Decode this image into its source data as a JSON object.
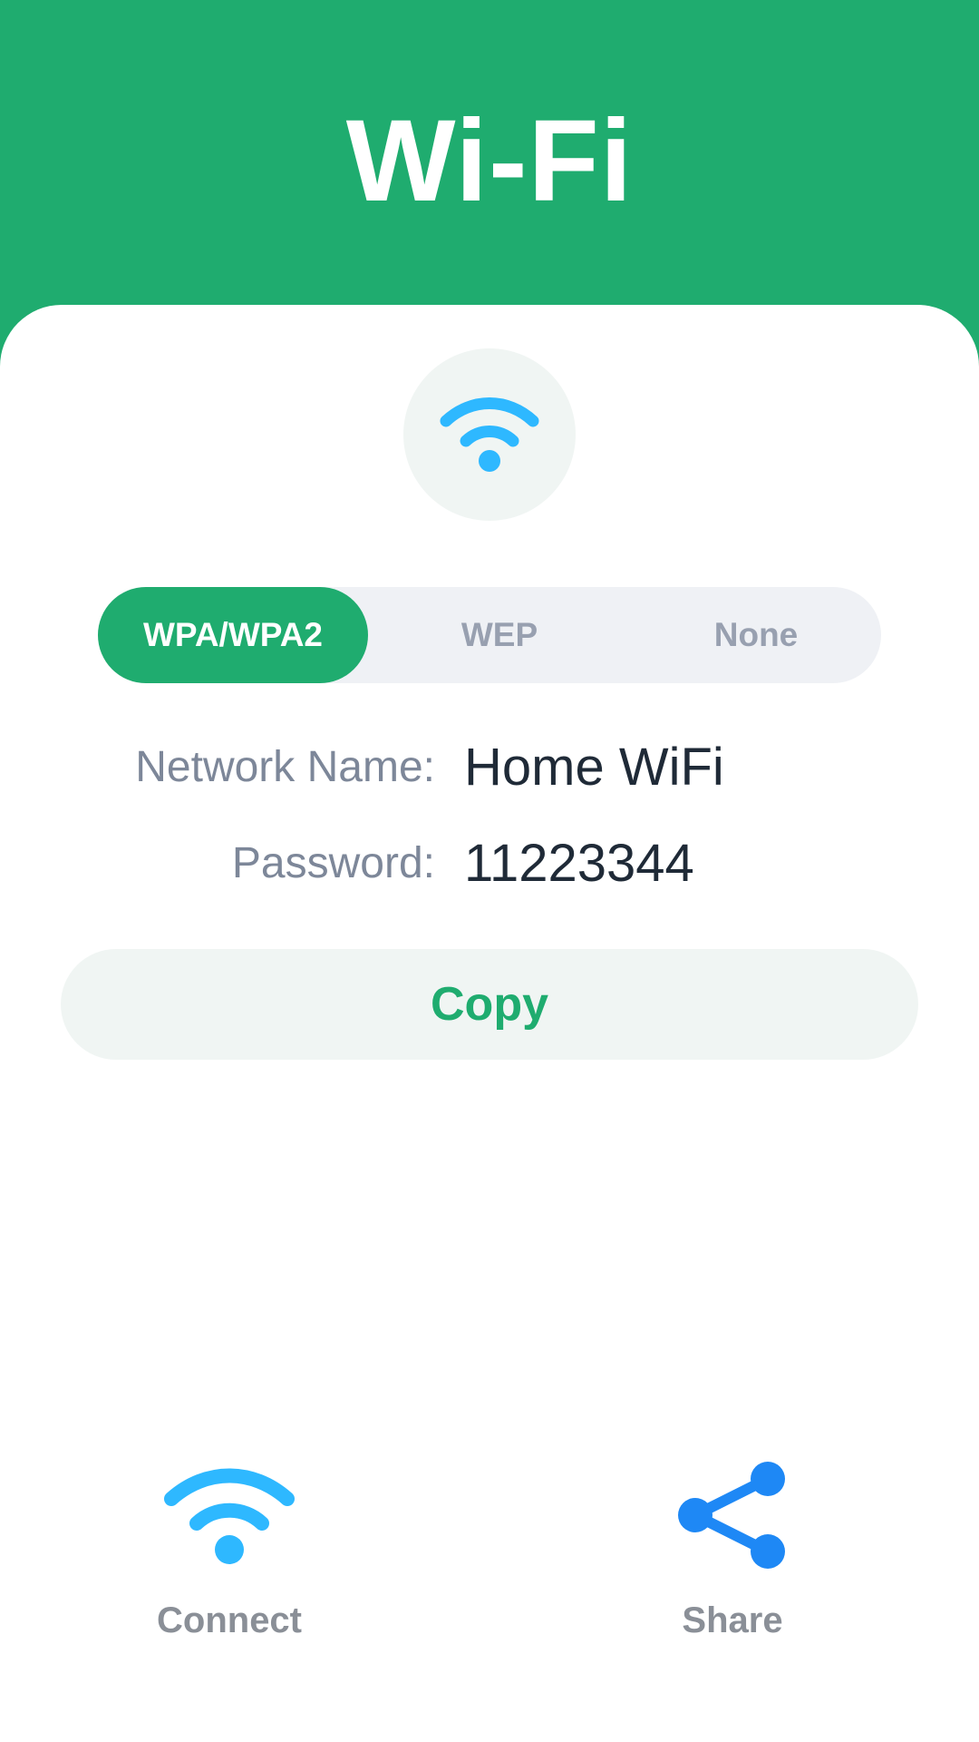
{
  "header": {
    "title": "Wi-Fi"
  },
  "security": {
    "options": [
      "WPA/WPA2",
      "WEP",
      "None"
    ],
    "selected": "WPA/WPA2"
  },
  "details": {
    "network_label": "Network Name:",
    "network_value": "Home WiFi",
    "password_label": "Password:",
    "password_value": "11223344"
  },
  "actions": {
    "copy_label": "Copy",
    "connect_label": "Connect",
    "share_label": "Share"
  },
  "icons": {
    "badge": "wifi-icon",
    "connect": "wifi-icon",
    "share": "share-icon"
  },
  "colors": {
    "brand_green": "#1FAC6F",
    "wifi_blue": "#2EB8FF",
    "share_blue": "#1E88F5",
    "label_gray": "#7D8799",
    "value_dark": "#1F2A37"
  }
}
